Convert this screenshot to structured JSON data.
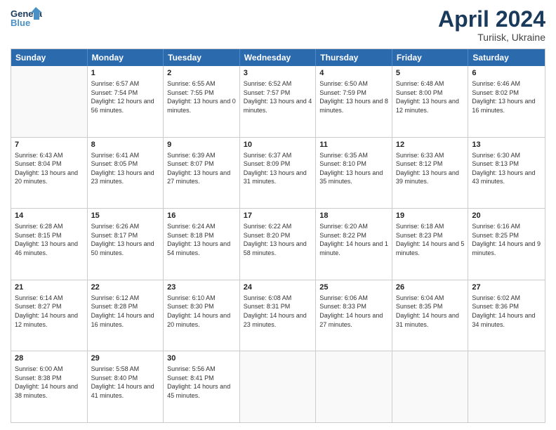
{
  "header": {
    "logo_text_general": "General",
    "logo_text_blue": "Blue",
    "month_title": "April 2024",
    "location": "Turiisk, Ukraine"
  },
  "days_of_week": [
    "Sunday",
    "Monday",
    "Tuesday",
    "Wednesday",
    "Thursday",
    "Friday",
    "Saturday"
  ],
  "weeks": [
    [
      {
        "day": "",
        "sunrise": "",
        "sunset": "",
        "daylight": "",
        "empty": true
      },
      {
        "day": "1",
        "sunrise": "Sunrise: 6:57 AM",
        "sunset": "Sunset: 7:54 PM",
        "daylight": "Daylight: 12 hours and 56 minutes.",
        "empty": false
      },
      {
        "day": "2",
        "sunrise": "Sunrise: 6:55 AM",
        "sunset": "Sunset: 7:55 PM",
        "daylight": "Daylight: 13 hours and 0 minutes.",
        "empty": false
      },
      {
        "day": "3",
        "sunrise": "Sunrise: 6:52 AM",
        "sunset": "Sunset: 7:57 PM",
        "daylight": "Daylight: 13 hours and 4 minutes.",
        "empty": false
      },
      {
        "day": "4",
        "sunrise": "Sunrise: 6:50 AM",
        "sunset": "Sunset: 7:59 PM",
        "daylight": "Daylight: 13 hours and 8 minutes.",
        "empty": false
      },
      {
        "day": "5",
        "sunrise": "Sunrise: 6:48 AM",
        "sunset": "Sunset: 8:00 PM",
        "daylight": "Daylight: 13 hours and 12 minutes.",
        "empty": false
      },
      {
        "day": "6",
        "sunrise": "Sunrise: 6:46 AM",
        "sunset": "Sunset: 8:02 PM",
        "daylight": "Daylight: 13 hours and 16 minutes.",
        "empty": false
      }
    ],
    [
      {
        "day": "7",
        "sunrise": "Sunrise: 6:43 AM",
        "sunset": "Sunset: 8:04 PM",
        "daylight": "Daylight: 13 hours and 20 minutes.",
        "empty": false
      },
      {
        "day": "8",
        "sunrise": "Sunrise: 6:41 AM",
        "sunset": "Sunset: 8:05 PM",
        "daylight": "Daylight: 13 hours and 23 minutes.",
        "empty": false
      },
      {
        "day": "9",
        "sunrise": "Sunrise: 6:39 AM",
        "sunset": "Sunset: 8:07 PM",
        "daylight": "Daylight: 13 hours and 27 minutes.",
        "empty": false
      },
      {
        "day": "10",
        "sunrise": "Sunrise: 6:37 AM",
        "sunset": "Sunset: 8:09 PM",
        "daylight": "Daylight: 13 hours and 31 minutes.",
        "empty": false
      },
      {
        "day": "11",
        "sunrise": "Sunrise: 6:35 AM",
        "sunset": "Sunset: 8:10 PM",
        "daylight": "Daylight: 13 hours and 35 minutes.",
        "empty": false
      },
      {
        "day": "12",
        "sunrise": "Sunrise: 6:33 AM",
        "sunset": "Sunset: 8:12 PM",
        "daylight": "Daylight: 13 hours and 39 minutes.",
        "empty": false
      },
      {
        "day": "13",
        "sunrise": "Sunrise: 6:30 AM",
        "sunset": "Sunset: 8:13 PM",
        "daylight": "Daylight: 13 hours and 43 minutes.",
        "empty": false
      }
    ],
    [
      {
        "day": "14",
        "sunrise": "Sunrise: 6:28 AM",
        "sunset": "Sunset: 8:15 PM",
        "daylight": "Daylight: 13 hours and 46 minutes.",
        "empty": false
      },
      {
        "day": "15",
        "sunrise": "Sunrise: 6:26 AM",
        "sunset": "Sunset: 8:17 PM",
        "daylight": "Daylight: 13 hours and 50 minutes.",
        "empty": false
      },
      {
        "day": "16",
        "sunrise": "Sunrise: 6:24 AM",
        "sunset": "Sunset: 8:18 PM",
        "daylight": "Daylight: 13 hours and 54 minutes.",
        "empty": false
      },
      {
        "day": "17",
        "sunrise": "Sunrise: 6:22 AM",
        "sunset": "Sunset: 8:20 PM",
        "daylight": "Daylight: 13 hours and 58 minutes.",
        "empty": false
      },
      {
        "day": "18",
        "sunrise": "Sunrise: 6:20 AM",
        "sunset": "Sunset: 8:22 PM",
        "daylight": "Daylight: 14 hours and 1 minute.",
        "empty": false
      },
      {
        "day": "19",
        "sunrise": "Sunrise: 6:18 AM",
        "sunset": "Sunset: 8:23 PM",
        "daylight": "Daylight: 14 hours and 5 minutes.",
        "empty": false
      },
      {
        "day": "20",
        "sunrise": "Sunrise: 6:16 AM",
        "sunset": "Sunset: 8:25 PM",
        "daylight": "Daylight: 14 hours and 9 minutes.",
        "empty": false
      }
    ],
    [
      {
        "day": "21",
        "sunrise": "Sunrise: 6:14 AM",
        "sunset": "Sunset: 8:27 PM",
        "daylight": "Daylight: 14 hours and 12 minutes.",
        "empty": false
      },
      {
        "day": "22",
        "sunrise": "Sunrise: 6:12 AM",
        "sunset": "Sunset: 8:28 PM",
        "daylight": "Daylight: 14 hours and 16 minutes.",
        "empty": false
      },
      {
        "day": "23",
        "sunrise": "Sunrise: 6:10 AM",
        "sunset": "Sunset: 8:30 PM",
        "daylight": "Daylight: 14 hours and 20 minutes.",
        "empty": false
      },
      {
        "day": "24",
        "sunrise": "Sunrise: 6:08 AM",
        "sunset": "Sunset: 8:31 PM",
        "daylight": "Daylight: 14 hours and 23 minutes.",
        "empty": false
      },
      {
        "day": "25",
        "sunrise": "Sunrise: 6:06 AM",
        "sunset": "Sunset: 8:33 PM",
        "daylight": "Daylight: 14 hours and 27 minutes.",
        "empty": false
      },
      {
        "day": "26",
        "sunrise": "Sunrise: 6:04 AM",
        "sunset": "Sunset: 8:35 PM",
        "daylight": "Daylight: 14 hours and 31 minutes.",
        "empty": false
      },
      {
        "day": "27",
        "sunrise": "Sunrise: 6:02 AM",
        "sunset": "Sunset: 8:36 PM",
        "daylight": "Daylight: 14 hours and 34 minutes.",
        "empty": false
      }
    ],
    [
      {
        "day": "28",
        "sunrise": "Sunrise: 6:00 AM",
        "sunset": "Sunset: 8:38 PM",
        "daylight": "Daylight: 14 hours and 38 minutes.",
        "empty": false
      },
      {
        "day": "29",
        "sunrise": "Sunrise: 5:58 AM",
        "sunset": "Sunset: 8:40 PM",
        "daylight": "Daylight: 14 hours and 41 minutes.",
        "empty": false
      },
      {
        "day": "30",
        "sunrise": "Sunrise: 5:56 AM",
        "sunset": "Sunset: 8:41 PM",
        "daylight": "Daylight: 14 hours and 45 minutes.",
        "empty": false
      },
      {
        "day": "",
        "sunrise": "",
        "sunset": "",
        "daylight": "",
        "empty": true
      },
      {
        "day": "",
        "sunrise": "",
        "sunset": "",
        "daylight": "",
        "empty": true
      },
      {
        "day": "",
        "sunrise": "",
        "sunset": "",
        "daylight": "",
        "empty": true
      },
      {
        "day": "",
        "sunrise": "",
        "sunset": "",
        "daylight": "",
        "empty": true
      }
    ]
  ]
}
